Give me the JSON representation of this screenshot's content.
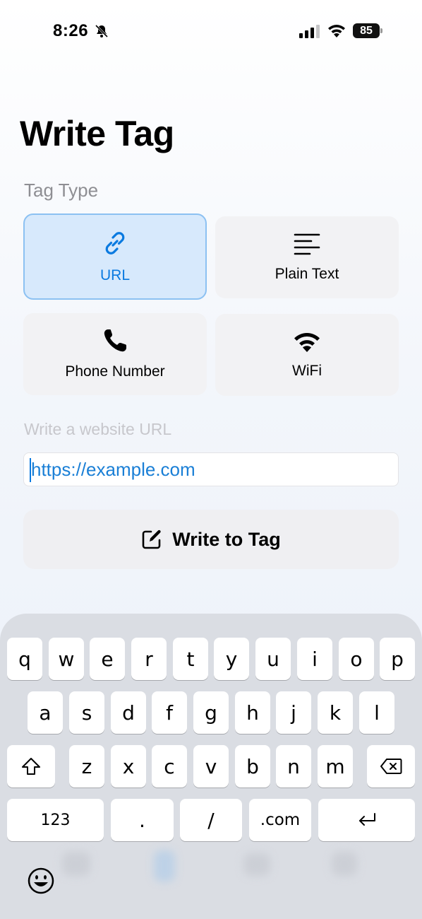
{
  "status_bar": {
    "time": "8:26",
    "battery": "85"
  },
  "title": "Write Tag",
  "tag_type_label": "Tag Type",
  "tag_types": [
    {
      "label": "URL",
      "icon": "link-icon",
      "selected": true
    },
    {
      "label": "Plain Text",
      "icon": "text-lines-icon",
      "selected": false
    },
    {
      "label": "Phone Number",
      "icon": "phone-icon",
      "selected": false
    },
    {
      "label": "WiFi",
      "icon": "wifi-icon",
      "selected": false
    }
  ],
  "url_field": {
    "label": "Write a website URL",
    "value": "https://example.com"
  },
  "write_button": {
    "label": "Write to Tag",
    "icon": "compose-icon"
  },
  "keyboard": {
    "row1": [
      "q",
      "w",
      "e",
      "r",
      "t",
      "y",
      "u",
      "i",
      "o",
      "p"
    ],
    "row2": [
      "a",
      "s",
      "d",
      "f",
      "g",
      "h",
      "j",
      "k",
      "l"
    ],
    "row3": [
      "z",
      "x",
      "c",
      "v",
      "b",
      "n",
      "m"
    ],
    "numbers_key": "123",
    "dot_key": ".",
    "slash_key": "/",
    "dotcom_key": ".com"
  },
  "colors": {
    "accent": "#0a7ae0",
    "selected_card_bg": "#d7e9fc",
    "card_bg": "#f2f2f4"
  }
}
